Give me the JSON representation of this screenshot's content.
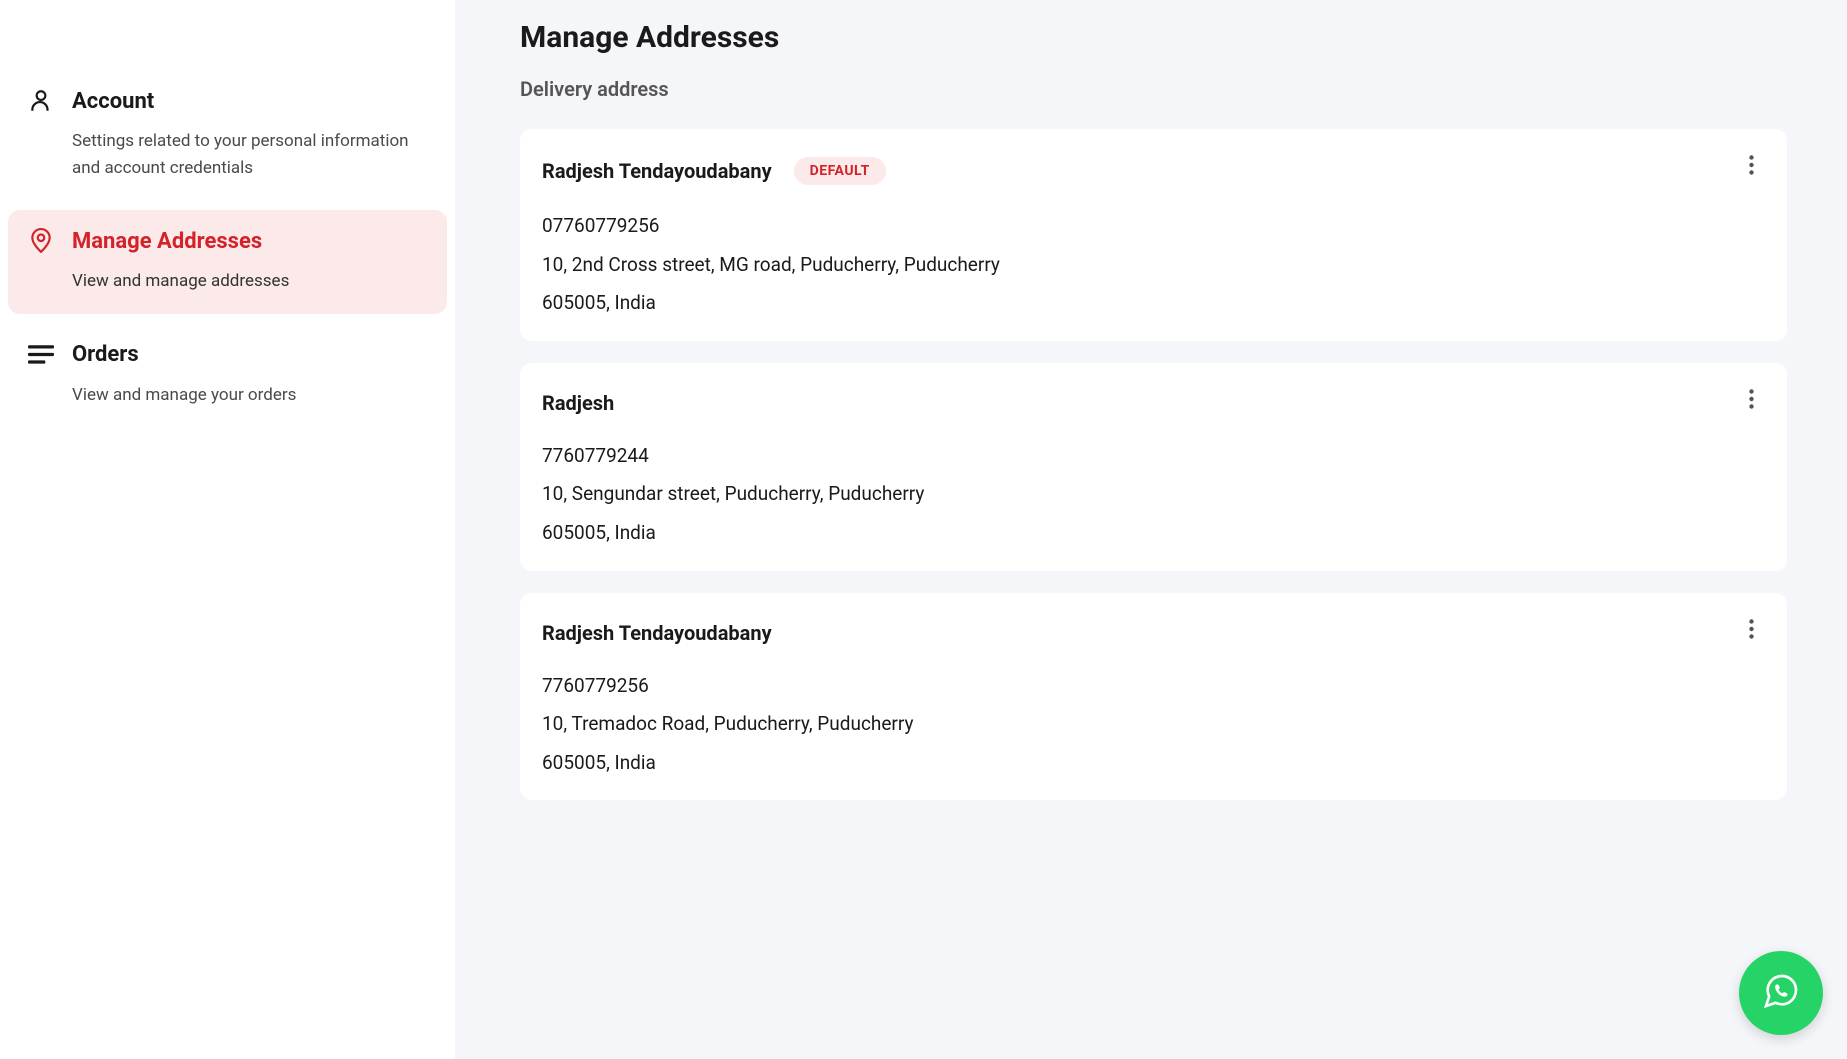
{
  "sidebar": {
    "items": [
      {
        "title": "Account",
        "description": "Settings related to your personal information and account credentials",
        "icon": "person",
        "active": false
      },
      {
        "title": "Manage Addresses",
        "description": "View and manage addresses",
        "icon": "location",
        "active": true
      },
      {
        "title": "Orders",
        "description": "View and manage your orders",
        "icon": "list",
        "active": false
      }
    ]
  },
  "main": {
    "page_title": "Manage Addresses",
    "section_title": "Delivery address",
    "default_label": "DEFAULT",
    "addresses": [
      {
        "name": "Radjesh Tendayoudabany",
        "is_default": true,
        "phone": "07760779256",
        "street": "10, 2nd Cross street, MG road, Puducherry, Puducherry",
        "postal": "605005, India"
      },
      {
        "name": "Radjesh",
        "is_default": false,
        "phone": "7760779244",
        "street": "10, Sengundar street, Puducherry, Puducherry",
        "postal": "605005, India"
      },
      {
        "name": "Radjesh Tendayoudabany",
        "is_default": false,
        "phone": "7760779256",
        "street": "10, Tremadoc Road, Puducherry, Puducherry",
        "postal": "605005, India"
      }
    ]
  },
  "colors": {
    "accent": "#d3232a",
    "accent_bg": "#fce9e9",
    "whatsapp": "#25d366"
  }
}
